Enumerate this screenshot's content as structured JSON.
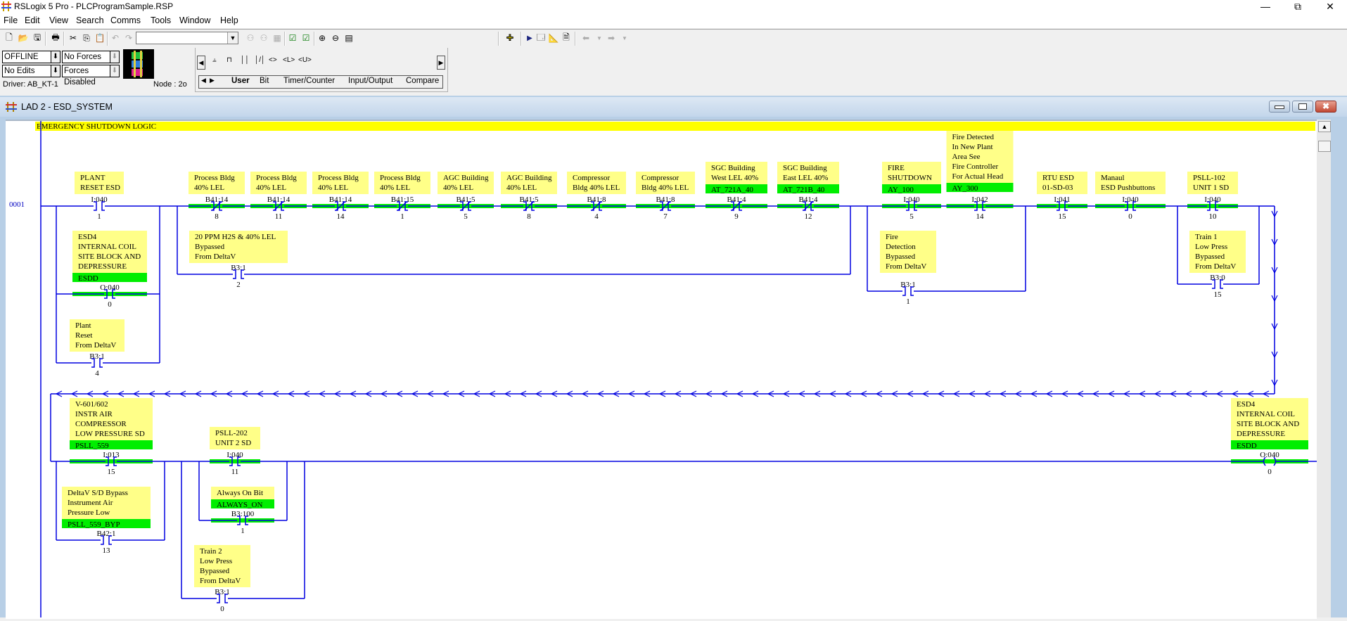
{
  "window": {
    "title": "RSLogix 5 Pro - PLCProgramSample.RSP",
    "controls": {
      "minimize": "—",
      "restore": "⧉",
      "close": "✕"
    }
  },
  "menu": [
    "File",
    "Edit",
    "View",
    "Search",
    "Comms",
    "Tools",
    "Window",
    "Help"
  ],
  "toolbar": {
    "search_combo_value": ""
  },
  "status": {
    "mode": "OFFLINE",
    "edits": "No Edits",
    "forces": "No Forces",
    "forces_enabled": "Forces Disabled",
    "driver": "Driver: AB_KT-1",
    "node": "Node :  2o"
  },
  "instruction_palette": {
    "tabs": [
      "User",
      "Bit",
      "Timer/Counter",
      "Input/Output",
      "Compare"
    ],
    "active_tab": "User"
  },
  "ladder_window": {
    "title": "LAD 2 - ESD_SYSTEM",
    "rung_comment": "EMERGENCY SHUTDOWN LOGIC",
    "rung_number": "0001",
    "colors": {
      "rail": "#0000e0",
      "energized": "#00ee00",
      "desc": "#ffff88",
      "symbol": "#00ee00",
      "comment": "#ffff00"
    }
  },
  "instructions": [
    {
      "id": "plant-reset-esd",
      "type": "XIC",
      "desc": [
        "PLANT",
        "RESET ESD"
      ],
      "symbol": "",
      "addr": "I:040",
      "bit": "1",
      "energized": false
    },
    {
      "id": "esd4-seal",
      "type": "XIC",
      "desc": [
        "ESD4",
        "INTERNAL COIL",
        "SITE BLOCK AND",
        "DEPRESSURE"
      ],
      "symbol": "ESDD",
      "addr": "O:040",
      "bit": "0",
      "energized": true
    },
    {
      "id": "plant-reset-deltav",
      "type": "XIC",
      "desc": [
        "Plant",
        "Reset",
        "From DeltaV"
      ],
      "symbol": "",
      "addr": "B3:1",
      "bit": "4",
      "energized": false
    },
    {
      "id": "process-bldg-1",
      "type": "XIO",
      "desc": [
        "Process Bldg",
        "40% LEL"
      ],
      "symbol": "",
      "addr": "B41:14",
      "bit": "8",
      "energized": true
    },
    {
      "id": "process-bldg-2",
      "type": "XIO",
      "desc": [
        "Process Bldg",
        "40% LEL"
      ],
      "symbol": "",
      "addr": "B41:14",
      "bit": "11",
      "energized": true
    },
    {
      "id": "process-bldg-3",
      "type": "XIO",
      "desc": [
        "Process Bldg",
        "40% LEL"
      ],
      "symbol": "",
      "addr": "B41:14",
      "bit": "14",
      "energized": true
    },
    {
      "id": "process-bldg-4",
      "type": "XIO",
      "desc": [
        "Process Bldg",
        "40% LEL"
      ],
      "symbol": "",
      "addr": "B41:15",
      "bit": "1",
      "energized": true
    },
    {
      "id": "agc-building-1",
      "type": "XIO",
      "desc": [
        "AGC Building",
        "40% LEL"
      ],
      "symbol": "",
      "addr": "B41:5",
      "bit": "5",
      "energized": true
    },
    {
      "id": "agc-building-2",
      "type": "XIO",
      "desc": [
        "AGC Building",
        "40% LEL"
      ],
      "symbol": "",
      "addr": "B41:5",
      "bit": "8",
      "energized": true
    },
    {
      "id": "compressor-bldg-1",
      "type": "XIO",
      "desc": [
        "Compressor",
        "Bldg 40% LEL"
      ],
      "symbol": "",
      "addr": "B41:8",
      "bit": "4",
      "energized": true
    },
    {
      "id": "compressor-bldg-2",
      "type": "XIO",
      "desc": [
        "Compressor",
        "Bldg 40% LEL"
      ],
      "symbol": "",
      "addr": "B41:8",
      "bit": "7",
      "energized": true
    },
    {
      "id": "sgc-west",
      "type": "XIO",
      "desc": [
        "SGC Building",
        "West LEL 40%"
      ],
      "symbol": "AT_721A_40",
      "addr": "B41:4",
      "bit": "9",
      "energized": true
    },
    {
      "id": "sgc-east",
      "type": "XIO",
      "desc": [
        "SGC Building",
        "East LEL 40%"
      ],
      "symbol": "AT_721B_40",
      "addr": "B41:4",
      "bit": "12",
      "energized": true
    },
    {
      "id": "h2s-bypass",
      "type": "XIC",
      "desc": [
        "20 PPM H2S & 40% LEL",
        "Bypassed",
        "From DeltaV"
      ],
      "symbol": "",
      "addr": "B3:1",
      "bit": "2",
      "energized": false
    },
    {
      "id": "fire-shutdown",
      "type": "XIC",
      "desc": [
        "FIRE",
        "SHUTDOWN"
      ],
      "symbol": "AY_100",
      "addr": "I:040",
      "bit": "5",
      "energized": true
    },
    {
      "id": "fire-detected",
      "type": "XIC",
      "desc": [
        "Fire Detected",
        "In New Plant",
        "Area See",
        "Fire Controller",
        "For Actual Head"
      ],
      "symbol": "AY_300",
      "addr": "I:042",
      "bit": "14",
      "energized": true
    },
    {
      "id": "fire-detection-bypass",
      "type": "XIC",
      "desc": [
        "Fire",
        "Detection",
        "Bypassed",
        "From DeltaV"
      ],
      "symbol": "",
      "addr": "B3:1",
      "bit": "1",
      "energized": false
    },
    {
      "id": "rtu-esd",
      "type": "XIC",
      "desc": [
        "RTU ESD",
        "01-SD-03"
      ],
      "symbol": "",
      "addr": "I:041",
      "bit": "15",
      "energized": true
    },
    {
      "id": "manual-esd",
      "type": "XIC",
      "desc": [
        "Manaul",
        "ESD Pushbuttons"
      ],
      "symbol": "",
      "addr": "I:040",
      "bit": "0",
      "energized": true
    },
    {
      "id": "psll-102",
      "type": "XIC",
      "desc": [
        "PSLL-102",
        "UNIT 1 SD"
      ],
      "symbol": "",
      "addr": "I:040",
      "bit": "10",
      "energized": true
    },
    {
      "id": "train1-bypass",
      "type": "XIC",
      "desc": [
        "Train 1",
        "Low Press",
        "Bypassed",
        "From DeltaV"
      ],
      "symbol": "",
      "addr": "B3:0",
      "bit": "15",
      "energized": false
    },
    {
      "id": "v601-602",
      "type": "XIC",
      "desc": [
        "V-601/602",
        "INSTR AIR",
        "COMPRESSOR",
        "LOW PRESSURE SD"
      ],
      "symbol": "PSLL_559",
      "addr": "I:013",
      "bit": "15",
      "energized": true
    },
    {
      "id": "deltav-sd-bypass",
      "type": "XIC",
      "desc": [
        "DeltaV S/D Bypass",
        "Instrument Air",
        "Pressure Low"
      ],
      "symbol": "PSLL_559_BYP",
      "addr": "B42:1",
      "bit": "13",
      "energized": false
    },
    {
      "id": "psll-202",
      "type": "XIC",
      "desc": [
        "PSLL-202",
        "UNIT 2 SD"
      ],
      "symbol": "",
      "addr": "I:040",
      "bit": "11",
      "energized": true
    },
    {
      "id": "always-on",
      "type": "XIC",
      "desc": [
        "Always On Bit"
      ],
      "symbol": "ALWAYS_ON",
      "addr": "B3:100",
      "bit": "1",
      "energized": true
    },
    {
      "id": "train2-bypass",
      "type": "XIC",
      "desc": [
        "Train 2",
        "Low Press",
        "Bypassed",
        "From DeltaV"
      ],
      "symbol": "",
      "addr": "B3:1",
      "bit": "0",
      "energized": false
    },
    {
      "id": "esd4-coil",
      "type": "OTE",
      "desc": [
        "ESD4",
        "INTERNAL COIL",
        "SITE BLOCK AND",
        "DEPRESSURE"
      ],
      "symbol": "ESDD",
      "addr": "O:040",
      "bit": "0",
      "energized": true
    }
  ]
}
